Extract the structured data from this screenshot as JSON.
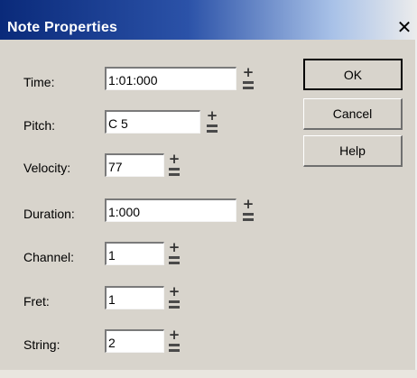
{
  "window": {
    "title": "Note Properties",
    "close_label": "✕"
  },
  "fields": [
    {
      "name": "time",
      "label": "Time:",
      "value": "1:01:000"
    },
    {
      "name": "pitch",
      "label": "Pitch:",
      "value": "C 5"
    },
    {
      "name": "velocity",
      "label": "Velocity:",
      "value": "77"
    },
    {
      "name": "duration",
      "label": "Duration:",
      "value": "1:000"
    },
    {
      "name": "channel",
      "label": "Channel:",
      "value": "1"
    },
    {
      "name": "fret",
      "label": "Fret:",
      "value": "1"
    },
    {
      "name": "string",
      "label": "String:",
      "value": "2"
    }
  ],
  "buttons": {
    "ok": "OK",
    "cancel": "Cancel",
    "help": "Help"
  },
  "spinner": {
    "plus_glyph": "+"
  }
}
